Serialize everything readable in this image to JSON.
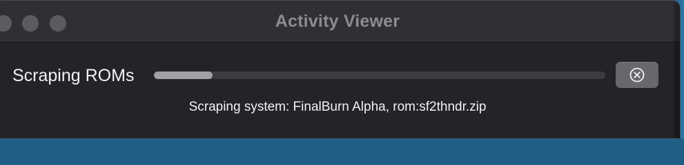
{
  "window": {
    "title": "Activity Viewer"
  },
  "task": {
    "label": "Scraping ROMs",
    "progress_fraction": 0.13,
    "status": "Scraping system: FinalBurn Alpha, rom:sf2thndr.zip"
  },
  "controls": {
    "cancel_icon": "close-circle-icon"
  },
  "colors": {
    "window_background": "#232428",
    "titlebar_background": "#302f35",
    "progress_track": "#3b3c41",
    "progress_fill": "#a0a1a6",
    "button_background": "#67686c",
    "desktop_accent": "#1f5f86"
  }
}
